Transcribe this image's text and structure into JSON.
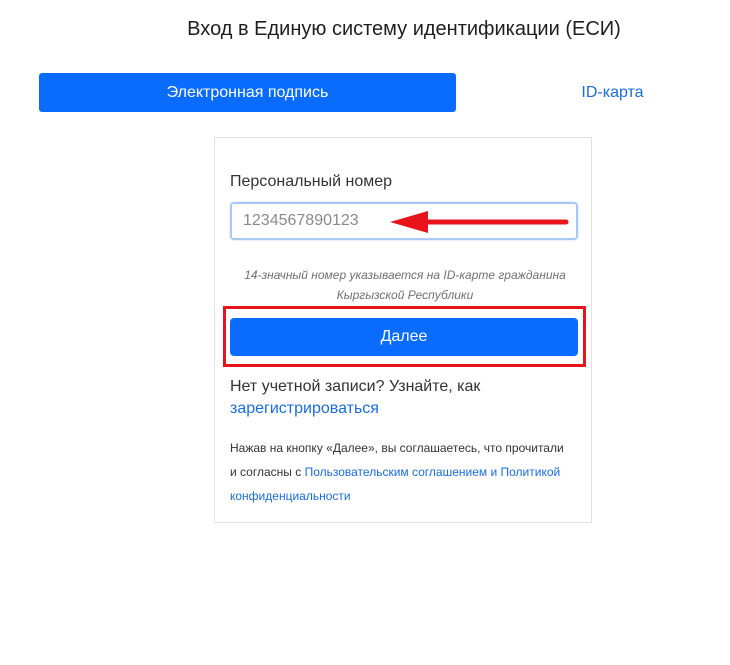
{
  "header": {
    "title": "Вход в Единую систему идентификации (ЕСИ)"
  },
  "tabs": [
    {
      "label": "Электронная подпись",
      "active": true
    },
    {
      "label": "ID-карта",
      "active": false
    }
  ],
  "form": {
    "field_label": "Персональный номер",
    "input_value": "",
    "input_placeholder": "1234567890123",
    "hint": "14-значный номер указывается на ID-карте гражданина Кыргызской Республики",
    "next_label": "Далее",
    "no_account_text": "Нет учетной записи? Узнайте, как",
    "register_link": "зарегистрироваться",
    "agreement_prefix": "Нажав на кнопку «Далее», вы соглашаетесь, что прочитали и согласны с",
    "agreement_link": "Пользовательским соглашением и Политикой конфиденциальности"
  },
  "colors": {
    "primary": "#0a6cff",
    "link": "#1a6de0",
    "annotation": "#e8131b"
  }
}
